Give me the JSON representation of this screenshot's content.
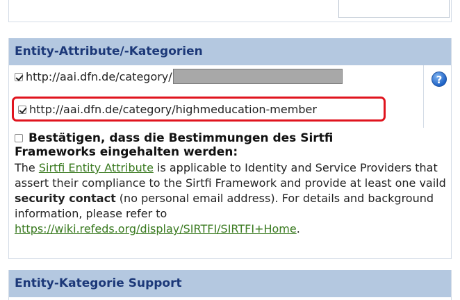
{
  "entity_attributes": {
    "header": "Entity-Attribute/-Kategorien",
    "rows": [
      {
        "label": "http://aai.dfn.de/category/",
        "checked": true,
        "value_redacted": true
      },
      {
        "label": "http://aai.dfn.de/category/highmeducation-member",
        "checked": true,
        "highlighted": true
      }
    ],
    "help_icon_glyph": "?",
    "sirtfi": {
      "checked": false,
      "title_line1": "Bestätigen, dass die Bestimmungen des Sirtfi",
      "title_line2": "Frameworks eingehalten werden:",
      "text_1": "The ",
      "link_attribute": "Sirtfi Entity Attribute",
      "text_2": " is applicable to Identity and Service Providers that assert their compliance to the Sirtfi Framework and provide at least one vaild ",
      "bold_security": "security contact",
      "text_3": " (no personal email address). For details and background information, please refer to ",
      "link_wiki": "https://wiki.refeds.org/display/SIRTFI/SIRTFI+Home",
      "text_4": "."
    }
  },
  "entity_category_support": {
    "header": "Entity-Kategorie Support"
  },
  "colors": {
    "header_bg": "#b4c8e0",
    "header_text": "#1c3878",
    "highlight_border": "#e0141e",
    "link": "#3a7a20"
  }
}
